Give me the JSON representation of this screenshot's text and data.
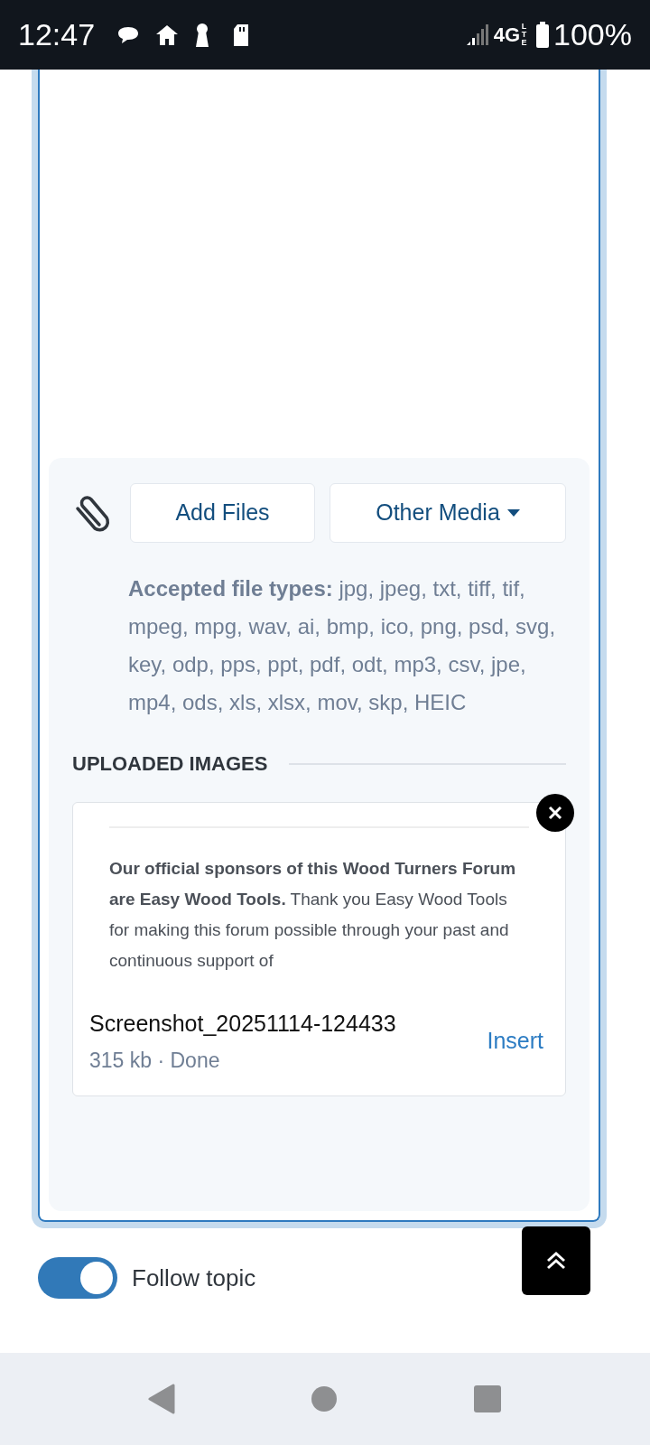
{
  "status_bar": {
    "time": "12:47",
    "network": "4G",
    "network_sub": "LTE",
    "battery": "100%"
  },
  "attachments": {
    "add_button": "Add Files",
    "media_button": "Other Media",
    "accepted": "**Accepted file types:** jpg, jpeg, txt, tiff, tif, mpeg, mpg, wav, ai, bmp, ico, png, psd, svg, key, odp, pps, ppt, pdf, odt, mp3, csv, jpe, mp4, ods, xls, xlsx, mov, skp, HEIC",
    "uploaded_heading": "UPLOADED IMAGES",
    "images": [
      {
        "preview_text": "**Our official sponsors of this Wood Turners Forum are Easy Wood Tools.** Thank you Easy Wood Tools for making this forum possible through your past and continuous support of",
        "filename": "Screenshot_20251114-124433",
        "meta": "315 kb · Done",
        "action": "Insert"
      }
    ]
  },
  "follow": {
    "label": "Follow topic",
    "on": true
  }
}
